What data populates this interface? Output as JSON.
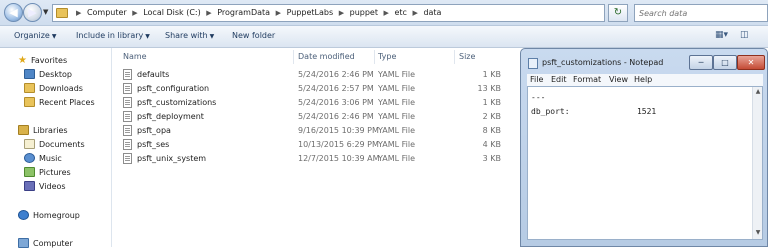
{
  "address_bar": {
    "crumbs": [
      "Computer",
      "Local Disk (C:)",
      "ProgramData",
      "PuppetLabs",
      "puppet",
      "etc",
      "data"
    ],
    "search_placeholder": "Search data"
  },
  "toolbar": {
    "organize": "Organize",
    "include_in_library": "Include in library",
    "share_with": "Share with",
    "new_folder": "New folder"
  },
  "nav_pane": {
    "favorites": "Favorites",
    "favorites_items": [
      "Desktop",
      "Downloads",
      "Recent Places"
    ],
    "libraries": "Libraries",
    "libraries_items": [
      "Documents",
      "Music",
      "Pictures",
      "Videos"
    ],
    "homegroup": "Homegroup",
    "computer": "Computer"
  },
  "file_list": {
    "columns": {
      "name": "Name",
      "date": "Date modified",
      "type": "Type",
      "size": "Size"
    },
    "rows": [
      {
        "name": "defaults",
        "date": "5/24/2016 2:46 PM",
        "type": "YAML File",
        "size": "1 KB"
      },
      {
        "name": "psft_configuration",
        "date": "5/24/2016 2:57 PM",
        "type": "YAML File",
        "size": "13 KB"
      },
      {
        "name": "psft_customizations",
        "date": "5/24/2016 3:06 PM",
        "type": "YAML File",
        "size": "1 KB"
      },
      {
        "name": "psft_deployment",
        "date": "5/24/2016 2:46 PM",
        "type": "YAML File",
        "size": "2 KB"
      },
      {
        "name": "psft_opa",
        "date": "9/16/2015 10:39 PM",
        "type": "YAML File",
        "size": "8 KB"
      },
      {
        "name": "psft_ses",
        "date": "10/13/2015 6:29 PM",
        "type": "YAML File",
        "size": "4 KB"
      },
      {
        "name": "psft_unix_system",
        "date": "12/7/2015 10:39 AM",
        "type": "YAML File",
        "size": "3 KB"
      }
    ]
  },
  "notepad": {
    "title": "psft_customizations - Notepad",
    "menu": [
      "File",
      "Edit",
      "Format",
      "View",
      "Help"
    ],
    "line1": "---",
    "line2": "db_port:              1521"
  }
}
